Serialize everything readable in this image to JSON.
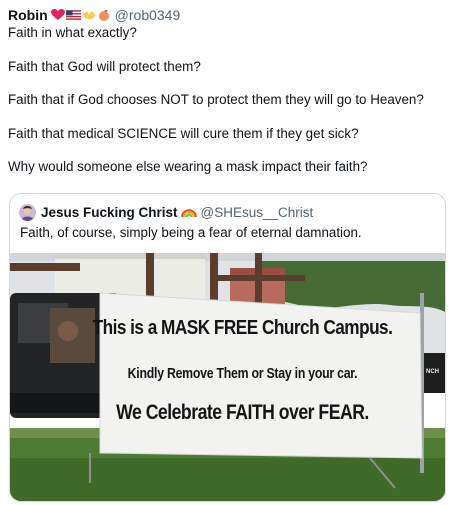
{
  "tweet": {
    "author_name": "Robin",
    "author_handle": "@rob0349",
    "author_emojis": [
      "red-heart-icon",
      "us-flag-icon",
      "hands-icon",
      "peach-icon"
    ],
    "body": [
      "Faith in what exactly?",
      "Faith that God will protect them?",
      "Faith that if God chooses NOT to protect them they will go to Heaven?",
      "Faith that medical SCIENCE will cure them if they get sick?",
      "Why would someone else wearing a mask impact their faith?"
    ]
  },
  "quote": {
    "author_name": "Jesus Fucking Christ",
    "author_emoji": "rainbow-icon",
    "author_handle": "@SHEsus__Christ",
    "text": "Faith, of course, simply being a fear of eternal damnation.",
    "photo": {
      "banner_line1": "This is a MASK FREE Church Campus.",
      "banner_line2": "Kindly Remove Them or Stay in your car.",
      "banner_line3": "We Celebrate FAITH over FEAR.",
      "trailer_sign": "NCH"
    }
  }
}
